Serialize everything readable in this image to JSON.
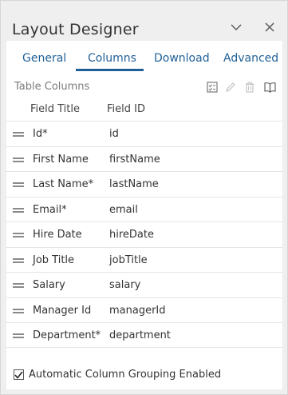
{
  "window": {
    "title": "Layout Designer"
  },
  "tabs": [
    {
      "label": "General"
    },
    {
      "label": "Columns",
      "active": true
    },
    {
      "label": "Download"
    },
    {
      "label": "Advanced"
    }
  ],
  "section": {
    "label": "Table Columns"
  },
  "toolbar": {
    "icons": [
      "checklist-icon",
      "edit-icon",
      "delete-icon",
      "book-icon"
    ]
  },
  "table": {
    "headers": {
      "title": "Field Title",
      "id": "Field ID"
    },
    "rows": [
      {
        "title": "Id*",
        "id": "id"
      },
      {
        "title": "First Name",
        "id": "firstName"
      },
      {
        "title": "Last Name*",
        "id": "lastName"
      },
      {
        "title": "Email*",
        "id": "email"
      },
      {
        "title": "Hire Date",
        "id": "hireDate"
      },
      {
        "title": "Job Title",
        "id": "jobTitle"
      },
      {
        "title": "Salary",
        "id": "salary"
      },
      {
        "title": "Manager Id",
        "id": "managerId"
      },
      {
        "title": "Department*",
        "id": "department"
      }
    ]
  },
  "grouping": {
    "label": "Automatic Column Grouping Enabled",
    "checked": true
  },
  "colors": {
    "accent": "#1f5f97",
    "frame": "#efefef"
  }
}
